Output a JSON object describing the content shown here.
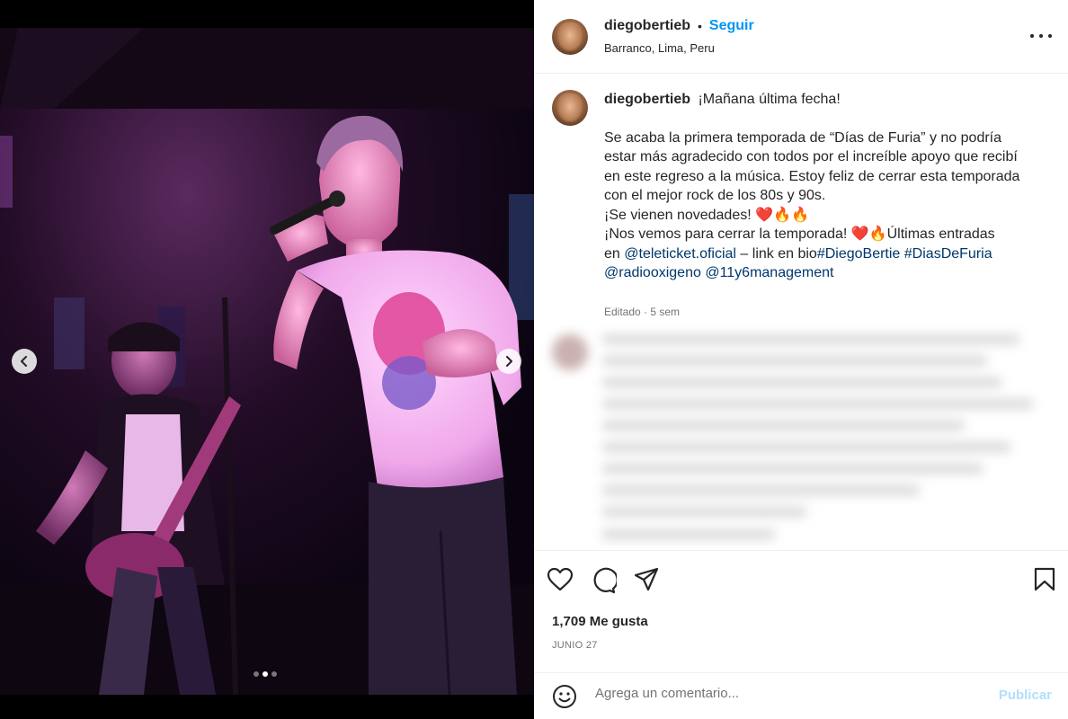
{
  "post": {
    "username": "diegobertieb",
    "separator": "•",
    "follow_label": "Seguir",
    "location": "Barranco, Lima, Peru",
    "more_label": "More options"
  },
  "caption": {
    "username": "diegobertieb",
    "first_line": "¡Mañana última fecha!",
    "lines": [
      "Se acaba la primera temporada de “Días de Furia” y no podría",
      "estar más agradecido con todos por el increíble apoyo que recibí",
      "en este regreso a la música. Estoy feliz de cerrar esta temporada",
      "con el mejor rock de los 80s y 90s.",
      "¡Se vienen novedades! ❤️🔥🔥",
      "¡Nos vemos para cerrar la temporada! ❤️🔥Últimas entradas"
    ],
    "line7_prefix": "en ",
    "mention_teleticket": "@teleticket.oficial",
    "line7_middle": " – link en bio",
    "hashtag_diego": "#DiegoBertie",
    "hashtag_dias": "#DiasDeFuria",
    "mention_radio": "@radiooxigeno",
    "mention_management": "@11y6management",
    "meta": "Editado · 5 sem"
  },
  "actions": {
    "likes": "1,709 Me gusta",
    "date": "JUNIO 27",
    "comment_placeholder": "Agrega un comentario...",
    "publish_label": "Publicar"
  },
  "carousel": {
    "total_slides": 3,
    "current_slide": 2
  },
  "colors": {
    "accent": "#0095f6",
    "link": "#00376b",
    "publish_disabled": "#b2dffc",
    "stage_light": "#e040c8"
  }
}
